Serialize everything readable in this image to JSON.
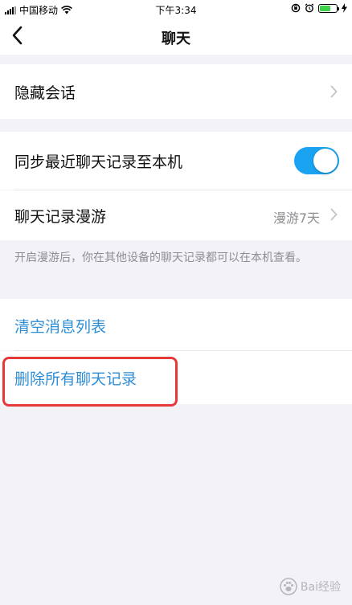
{
  "status_bar": {
    "carrier": "中国移动",
    "time": "下午3:34"
  },
  "nav": {
    "title": "聊天"
  },
  "hidden_chats": {
    "label": "隐藏会话"
  },
  "sync": {
    "label": "同步最近聊天记录至本机",
    "enabled": true
  },
  "roaming": {
    "label": "聊天记录漫游",
    "value": "漫游7天"
  },
  "note": "开启漫游后，你在其他设备的聊天记录都可以在本机查看。",
  "actions": {
    "clear_list": "清空消息列表",
    "delete_all": "删除所有聊天记录"
  },
  "colors": {
    "accent": "#1aa3f0",
    "link": "#2e8ed6",
    "highlight": "#e63a3a",
    "background": "#f2f2f7"
  },
  "watermark": {
    "brand": "Bai经验"
  }
}
